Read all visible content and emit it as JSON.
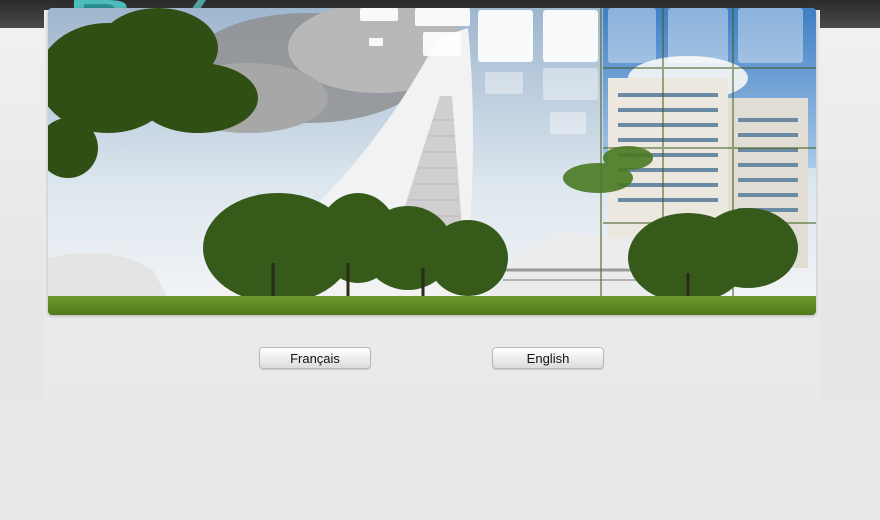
{
  "header": {
    "logo_icon": "d-logo-icon"
  },
  "hero": {
    "image": "olympic-stadium-montreal-photo"
  },
  "language_choice": {
    "french_label": "Français",
    "english_label": "English"
  },
  "colors": {
    "top_bar": "#333333",
    "logo_teal": "#5ec8c8",
    "page_background": "#e9e9e9",
    "button_border": "#b9b9b9"
  }
}
